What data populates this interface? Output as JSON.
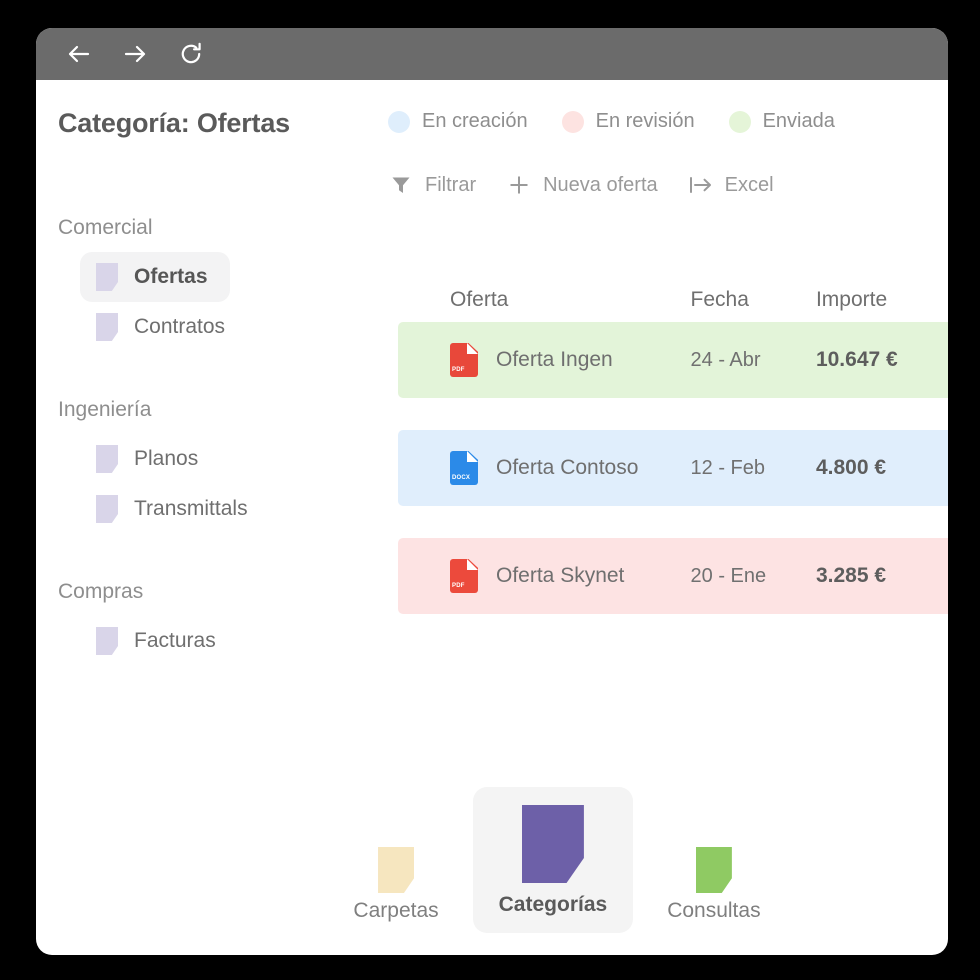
{
  "window": {
    "chrome": {
      "back_icon": "arrow-left-icon",
      "forward_icon": "arrow-right-icon",
      "reload_icon": "reload-icon",
      "bar_color": "#6b6b6b"
    }
  },
  "header": {
    "title": "Categoría: Ofertas"
  },
  "legend": {
    "items": [
      {
        "label": "En creación",
        "color": "#dfeefc",
        "state": "en-creacion"
      },
      {
        "label": "En revisión",
        "color": "#fde3e1",
        "state": "en-revision"
      },
      {
        "label": "Enviada",
        "color": "#e5f5d8",
        "state": "enviada"
      }
    ]
  },
  "toolbar": {
    "items": [
      {
        "label": "Filtrar",
        "icon": "filter-icon"
      },
      {
        "label": "Nueva oferta",
        "icon": "plus-icon"
      },
      {
        "label": "Excel",
        "icon": "export-icon"
      }
    ]
  },
  "sidebar": {
    "groups": [
      {
        "title": "Comercial",
        "items": [
          {
            "label": "Ofertas",
            "active": true
          },
          {
            "label": "Contratos",
            "active": false
          }
        ]
      },
      {
        "title": "Ingeniería",
        "items": [
          {
            "label": "Planos",
            "active": false
          },
          {
            "label": "Transmittals",
            "active": false
          }
        ]
      },
      {
        "title": "Compras",
        "items": [
          {
            "label": "Facturas",
            "active": false
          }
        ]
      }
    ],
    "icon_color": "#d9d5e9"
  },
  "table": {
    "columns": [
      "Oferta",
      "Fecha",
      "Importe"
    ],
    "rows": [
      {
        "name": "Oferta Ingen",
        "date": "24 - Abr",
        "amount": "10.647 €",
        "file_type": "PDF",
        "file_icon": "pdf-file-icon",
        "file_color": "#e8483a",
        "row_color": "#e3f4d9",
        "status": "Enviada"
      },
      {
        "name": "Oferta Contoso",
        "date": "12 - Feb",
        "amount": "4.800 €",
        "file_type": "DOCX",
        "file_icon": "docx-file-icon",
        "file_color": "#2b8ae8",
        "row_color": "#e0eefc",
        "status": "En creación"
      },
      {
        "name": "Oferta Skynet",
        "date": "20 - Ene",
        "amount": "3.285 €",
        "file_type": "PDF",
        "file_icon": "pdf-file-icon",
        "file_color": "#ec4a3c",
        "row_color": "#fde3e3",
        "status": "En revisión"
      }
    ]
  },
  "bottom_nav": {
    "items": [
      {
        "label": "Carpetas",
        "color": "#f6e6bf",
        "active": false
      },
      {
        "label": "Categorías",
        "color": "#6d60a8",
        "active": true
      },
      {
        "label": "Consultas",
        "color": "#8fca63",
        "active": false
      }
    ]
  }
}
